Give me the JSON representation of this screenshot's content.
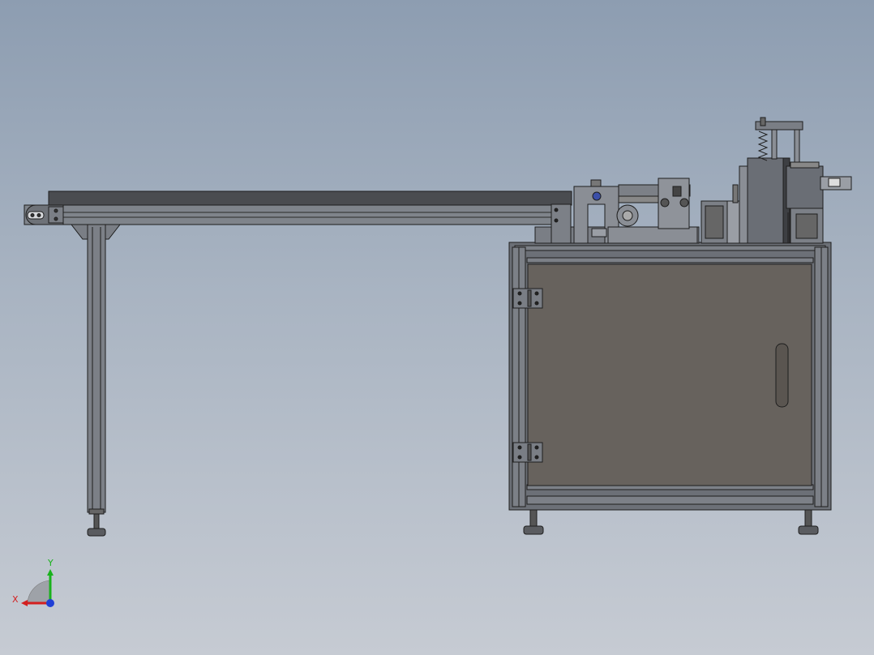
{
  "view": {
    "background_top": "#8d9db1",
    "background_bottom": "#c6cbd3",
    "line_color": "#1e1e1e",
    "frame_color": "#6c7077",
    "cabinet_panel_color": "#67625d",
    "belt_color": "#4a4c50"
  },
  "triad": {
    "x_label": "X",
    "y_label": "Y",
    "x_color": "#d31f1f",
    "y_color": "#19b21c",
    "z_color": "#1f3fd6"
  }
}
